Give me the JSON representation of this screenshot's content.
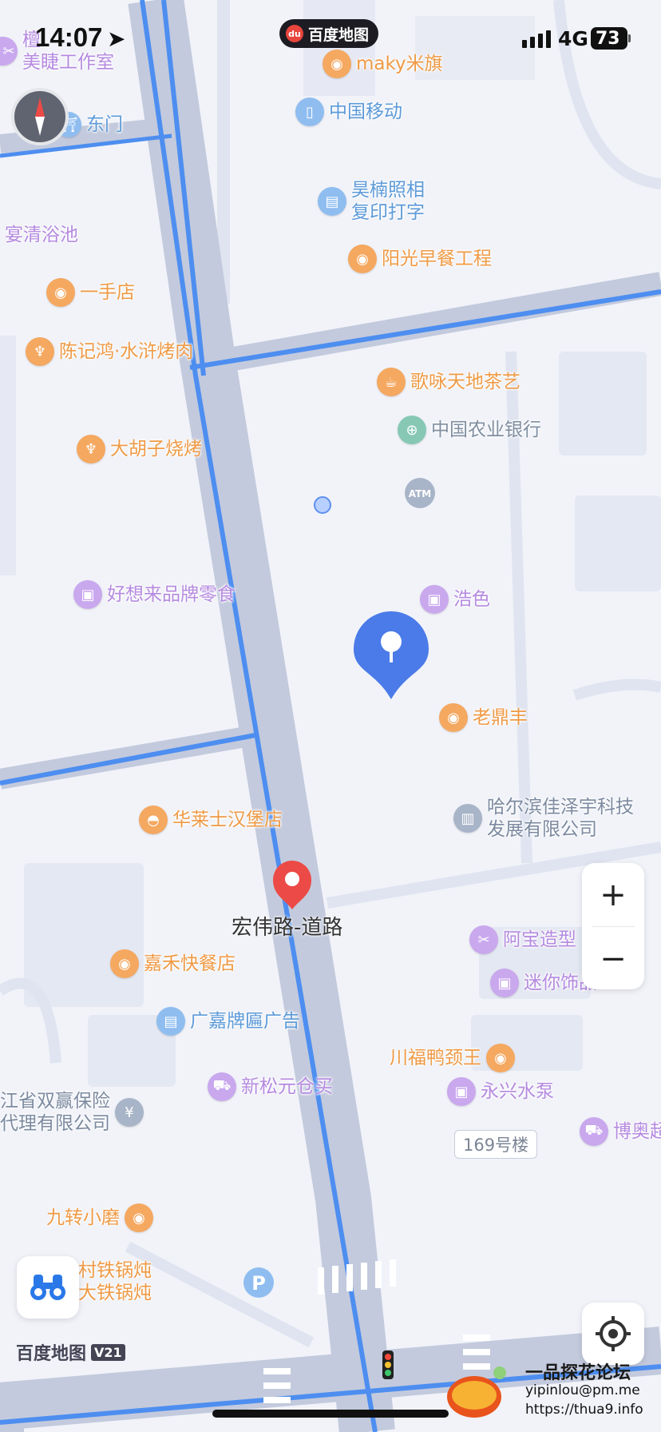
{
  "status_bar": {
    "time": "14:07",
    "network": "4G",
    "battery": "73"
  },
  "brand_pill": "百度地图",
  "pois": [
    {
      "id": "maky",
      "label": "maky米旗",
      "type": "food"
    },
    {
      "id": "mobile",
      "label": "中国移动",
      "type": "serv"
    },
    {
      "id": "photo1",
      "label": "昊楠照相",
      "type": "serv"
    },
    {
      "id": "photo2",
      "label": "复印打字",
      "type": "serv"
    },
    {
      "id": "breakfast",
      "label": "阳光早餐工程",
      "type": "food"
    },
    {
      "id": "bath",
      "label": "宴清浴池",
      "type": "shop"
    },
    {
      "id": "yishou",
      "label": "一手店",
      "type": "food"
    },
    {
      "id": "bbq1",
      "label": "陈记鸿·水浒烤肉",
      "type": "food"
    },
    {
      "id": "tea",
      "label": "歌咏天地茶艺",
      "type": "food"
    },
    {
      "id": "abc",
      "label": "中国农业银行",
      "type": "green"
    },
    {
      "id": "bbq2",
      "label": "大胡子烧烤",
      "type": "food"
    },
    {
      "id": "snack",
      "label": "好想来品牌零食",
      "type": "shop"
    },
    {
      "id": "haose",
      "label": "浩色",
      "type": "shop"
    },
    {
      "id": "laoding",
      "label": "老鼎丰",
      "type": "food"
    },
    {
      "id": "tech1",
      "label": "哈尔滨佳泽宇科技",
      "type": "grey"
    },
    {
      "id": "tech2",
      "label": "发展有限公司",
      "type": "grey"
    },
    {
      "id": "burger",
      "label": "华莱士汉堡店",
      "type": "food"
    },
    {
      "id": "abao",
      "label": "阿宝造型",
      "type": "shop"
    },
    {
      "id": "jiahe",
      "label": "嘉禾快餐店",
      "type": "food"
    },
    {
      "id": "mini",
      "label": "迷你饰品",
      "type": "shop"
    },
    {
      "id": "ad",
      "label": "广嘉牌匾广告",
      "type": "serv"
    },
    {
      "id": "duck",
      "label": "川福鸭颈王",
      "type": "food"
    },
    {
      "id": "songyuan",
      "label": "新松元仓买",
      "type": "shop"
    },
    {
      "id": "pump",
      "label": "永兴水泵",
      "type": "shop"
    },
    {
      "id": "ins1",
      "label": "江省双赢保险",
      "type": "grey"
    },
    {
      "id": "ins2",
      "label": "代理有限公司",
      "type": "grey"
    },
    {
      "id": "boao",
      "label": "博奥超",
      "type": "shop"
    },
    {
      "id": "mill",
      "label": "九转小磨",
      "type": "food"
    },
    {
      "id": "stew1",
      "label": "村铁锅炖",
      "type": "food"
    },
    {
      "id": "stew2",
      "label": "大铁锅炖",
      "type": "food"
    },
    {
      "id": "beauty1",
      "label": "檀",
      "type": "shop"
    },
    {
      "id": "beauty2",
      "label": "美睫工作室",
      "type": "shop"
    },
    {
      "id": "dongmen",
      "label": "东门",
      "type": "serv"
    }
  ],
  "road_label": "宏伟路-道路",
  "building_label": "169号楼",
  "map_logo": {
    "text": "百度地图",
    "version": "V21"
  },
  "watermark": {
    "title": "一品探花论坛",
    "email": "yipinlou@pm.me",
    "url": "https://thua9.info"
  },
  "controls": {
    "zoom_in": "+",
    "zoom_out": "−"
  },
  "colors": {
    "road_blue": "#4d8ef0",
    "road_grey": "#c3cadd",
    "pin_blue": "#4a7be8",
    "pin_red": "#ec4a46"
  }
}
